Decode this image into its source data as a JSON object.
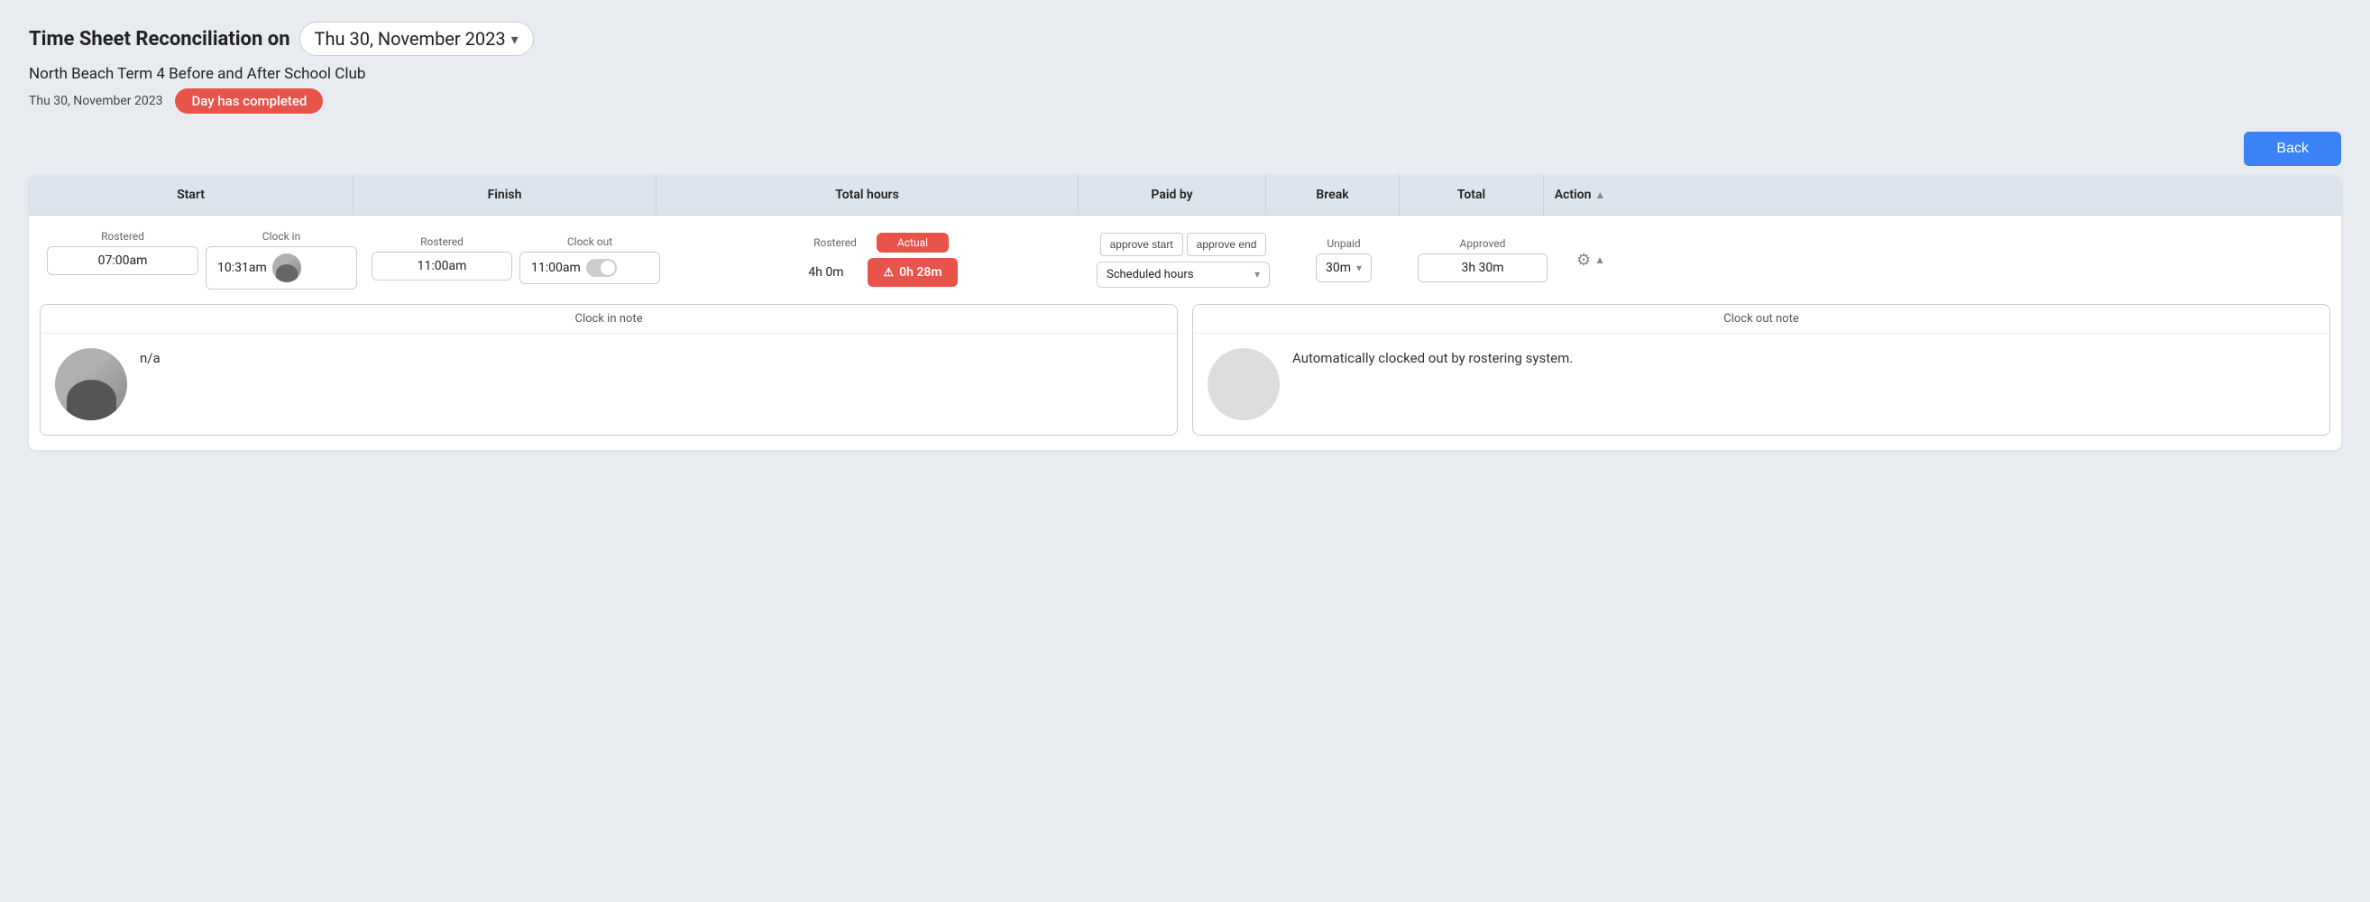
{
  "page": {
    "title_prefix": "Time Sheet Reconciliation on",
    "date_label": "Thu 30, November 2023",
    "subtitle": "North Beach Term 4 Before and After School Club",
    "status_date": "Thu 30, November 2023",
    "status_badge": "Day has completed",
    "back_button": "Back"
  },
  "table": {
    "headers": {
      "start": "Start",
      "finish": "Finish",
      "total_hours": "Total hours",
      "paid_by": "Paid by",
      "break": "Break",
      "total": "Total",
      "action": "Action"
    },
    "row": {
      "start_rostered_label": "Rostered",
      "start_clock_in_label": "Clock in",
      "start_rostered_value": "07:00am",
      "start_clock_in_value": "10:31am",
      "finish_rostered_label": "Rostered",
      "finish_clock_out_label": "Clock out",
      "finish_rostered_value": "11:00am",
      "finish_clock_out_value": "11:00am",
      "total_rostered_label": "Rostered",
      "total_actual_label": "Actual",
      "total_rostered_value": "4h 0m",
      "total_actual_value": "0h 28m",
      "approve_start_label": "approve start",
      "approve_end_label": "approve end",
      "paid_by_select": "Scheduled hours",
      "break_label": "Unpaid",
      "break_value": "30m",
      "total_value": "3h 30m",
      "total_sub_label": "Approved"
    },
    "notes": {
      "clock_in_header": "Clock in note",
      "clock_in_note": "n/a",
      "clock_out_header": "Clock out note",
      "clock_out_note": "Automatically clocked out by rostering system."
    }
  }
}
